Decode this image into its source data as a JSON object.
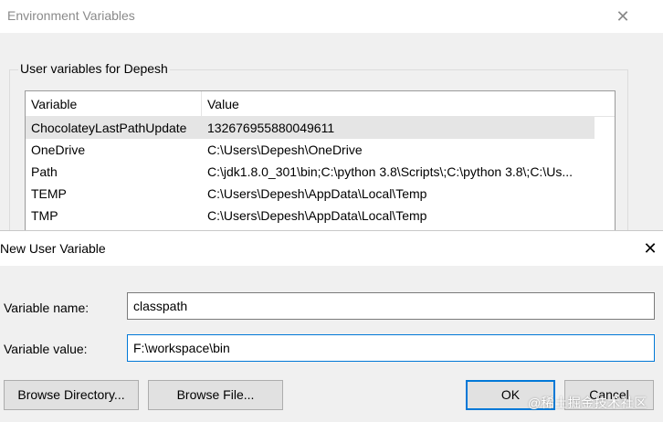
{
  "env_dialog": {
    "title": "Environment Variables",
    "group_label": "User variables for Depesh",
    "columns": [
      "Variable",
      "Value"
    ],
    "rows": [
      {
        "variable": "ChocolateyLastPathUpdate",
        "value": "132676955880049611"
      },
      {
        "variable": "OneDrive",
        "value": "C:\\Users\\Depesh\\OneDrive"
      },
      {
        "variable": "Path",
        "value": "C:\\jdk1.8.0_301\\bin;C:\\python 3.8\\Scripts\\;C:\\python 3.8\\;C:\\Us..."
      },
      {
        "variable": "TEMP",
        "value": "C:\\Users\\Depesh\\AppData\\Local\\Temp"
      },
      {
        "variable": "TMP",
        "value": "C:\\Users\\Depesh\\AppData\\Local\\Temp"
      }
    ],
    "selected_row": 0
  },
  "new_var_dialog": {
    "title": "New User Variable",
    "name_label": "Variable name:",
    "name_value": "classpath",
    "value_label": "Variable value:",
    "value_value": "F:\\workspace\\bin",
    "browse_directory_label": "Browse Directory...",
    "browse_file_label": "Browse File...",
    "ok_label": "OK",
    "cancel_label": "Cancel"
  },
  "watermark": "@稀土掘金技术社区",
  "icons": {
    "close": "close-icon"
  },
  "colors": {
    "accent": "#0078d7",
    "selection": "#e5e5e5",
    "button": "#e1e1e1"
  }
}
